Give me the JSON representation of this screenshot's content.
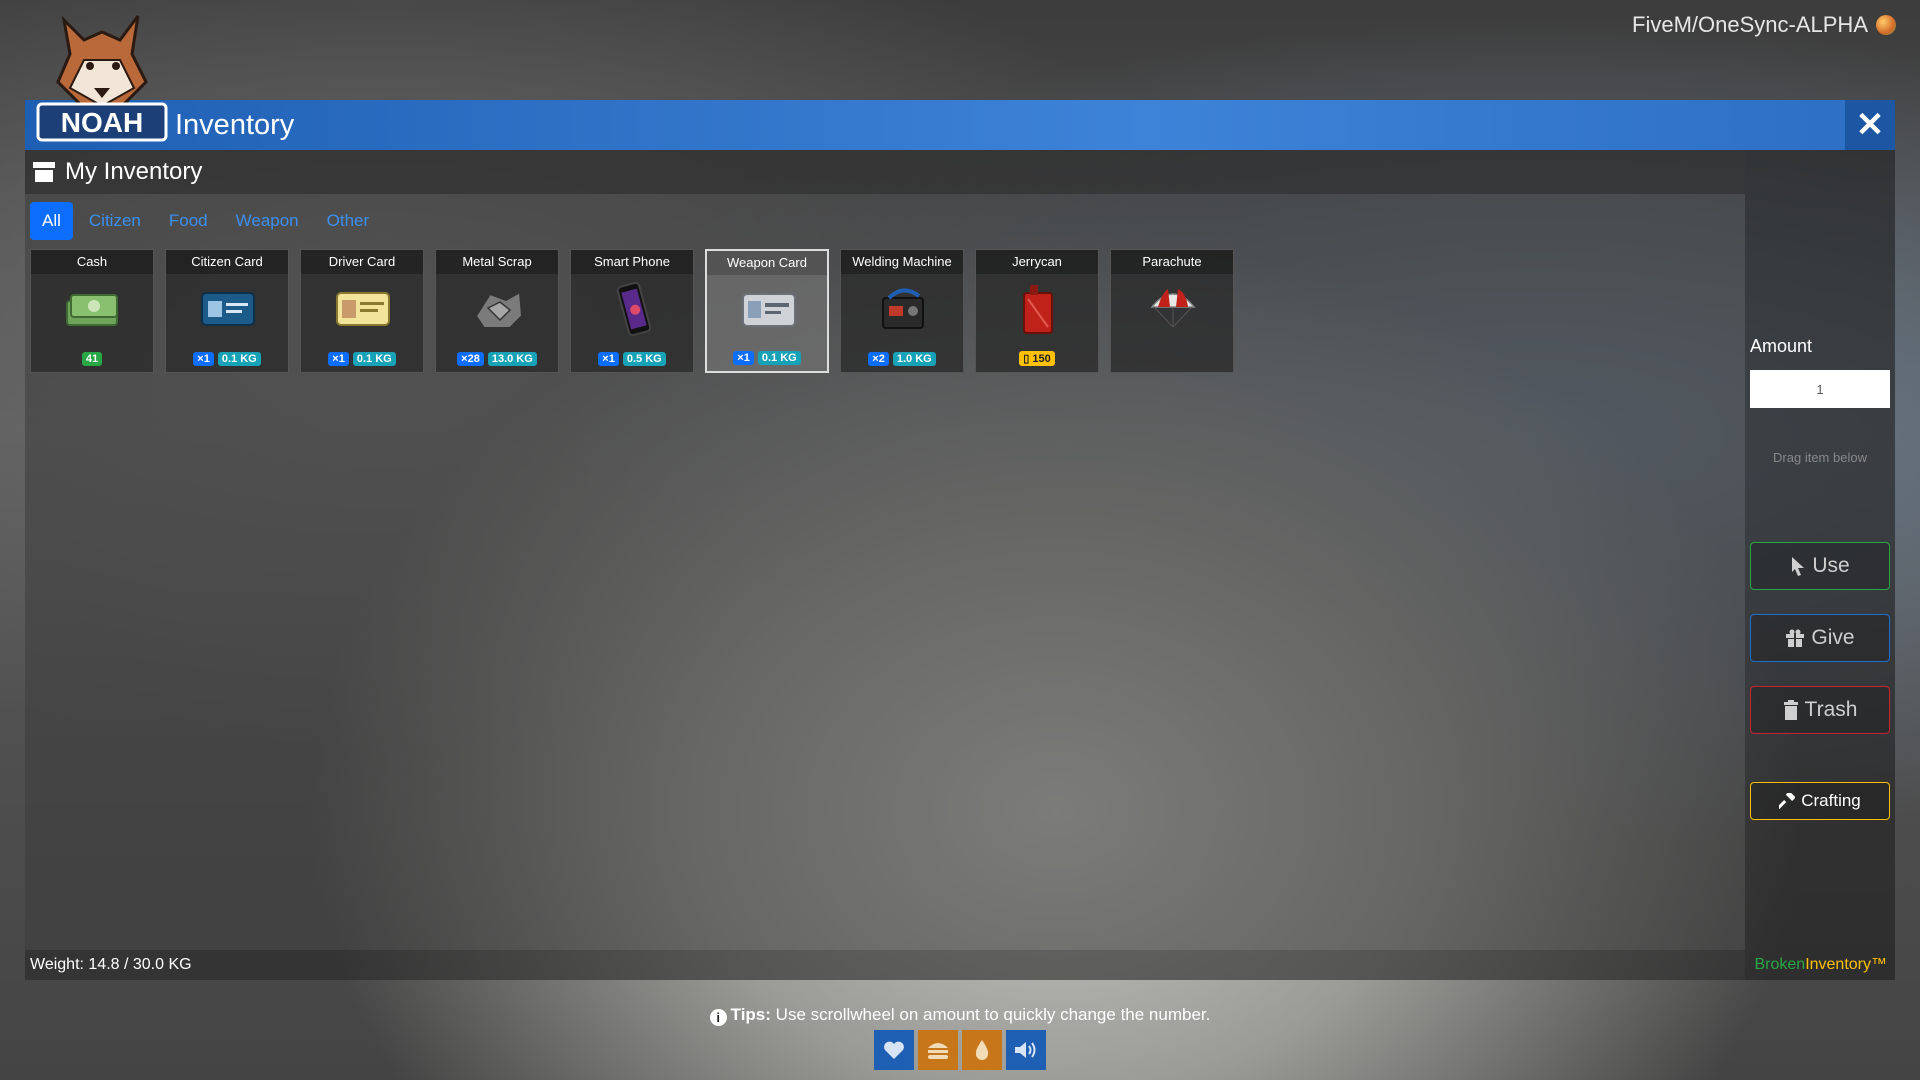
{
  "server": {
    "label": "FiveM/OneSync-ALPHA"
  },
  "window": {
    "title": "Inventory",
    "logo_text": "NOAH"
  },
  "main": {
    "header": "My Inventory"
  },
  "tabs": [
    {
      "label": "All",
      "active": true
    },
    {
      "label": "Citizen",
      "active": false
    },
    {
      "label": "Food",
      "active": false
    },
    {
      "label": "Weapon",
      "active": false
    },
    {
      "label": "Other",
      "active": false
    }
  ],
  "items": [
    {
      "name": "Cash",
      "icon": "cash-icon",
      "money": "41"
    },
    {
      "name": "Citizen Card",
      "icon": "id-card-icon",
      "count": "×1",
      "weight": "0.1 KG"
    },
    {
      "name": "Driver Card",
      "icon": "driver-card-icon",
      "count": "×1",
      "weight": "0.1 KG"
    },
    {
      "name": "Metal Scrap",
      "icon": "metal-scrap-icon",
      "count": "×28",
      "weight": "13.0 KG"
    },
    {
      "name": "Smart Phone",
      "icon": "phone-icon",
      "count": "×1",
      "weight": "0.5 KG"
    },
    {
      "name": "Weapon Card",
      "icon": "weapon-card-icon",
      "count": "×1",
      "weight": "0.1 KG",
      "selected": true
    },
    {
      "name": "Welding Machine",
      "icon": "welding-machine-icon",
      "count": "×2",
      "weight": "1.0 KG"
    },
    {
      "name": "Jerrycan",
      "icon": "jerrycan-icon",
      "fuel": "150"
    },
    {
      "name": "Parachute",
      "icon": "parachute-icon"
    }
  ],
  "sidebar": {
    "amount_label": "Amount",
    "amount_value": "1",
    "drag_hint": "Drag item below",
    "use_label": "Use",
    "give_label": "Give",
    "trash_label": "Trash",
    "crafting_label": "Crafting",
    "brand_part1": "Broken",
    "brand_part2": "Inventory™"
  },
  "footer": {
    "weight": "Weight: 14.8 / 30.0 KG"
  },
  "tips": {
    "prefix": "Tips:",
    "text": " Use scrollwheel on amount to quickly change the number."
  },
  "status_icons": [
    "heart-icon",
    "burger-icon",
    "water-drop-icon",
    "speaker-icon"
  ],
  "colors": {
    "title_blue": "#3d83d8",
    "tab_active": "#0d6efd",
    "use": "#28a745",
    "give": "#1f6fd1",
    "trash": "#c82333",
    "craft": "#ffc107"
  }
}
